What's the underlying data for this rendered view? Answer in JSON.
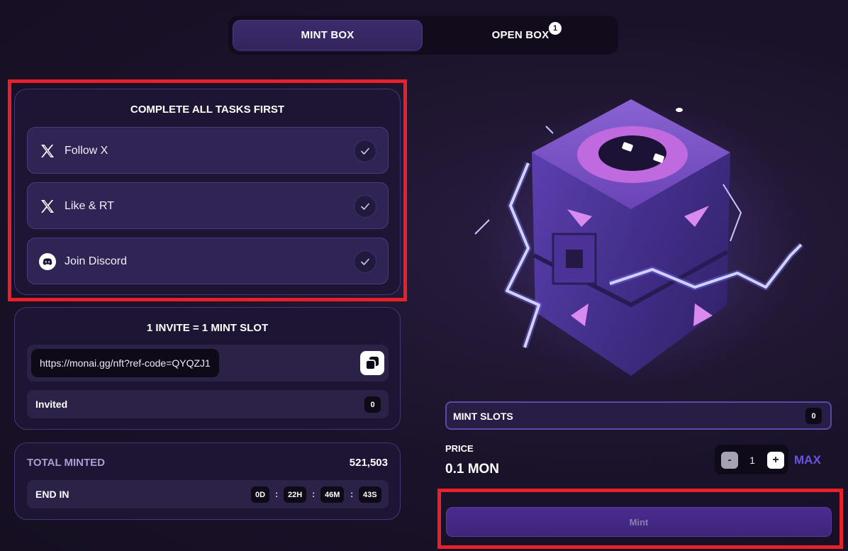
{
  "tabs": [
    {
      "label": "MINT BOX",
      "active": true
    },
    {
      "label": "OPEN BOX",
      "badge": "1"
    }
  ],
  "tasks": {
    "title": "COMPLETE ALL TASKS FIRST",
    "items": [
      {
        "label": "Follow X",
        "icon": "x-logo-icon",
        "done": true
      },
      {
        "label": "Like & RT",
        "icon": "x-logo-icon",
        "done": true
      },
      {
        "label": "Join Discord",
        "icon": "discord-icon",
        "done": true
      }
    ]
  },
  "invite": {
    "title": "1 INVITE = 1 MINT SLOT",
    "link": "https://monai.gg/nft?ref-code=QYQZJ1",
    "invited_label": "Invited",
    "invited_count": "0"
  },
  "stats": {
    "total_label": "TOTAL MINTED",
    "total_value": "521,503",
    "end_label": "END IN",
    "countdown": {
      "days": "0D",
      "hours": "22H",
      "minutes": "46M",
      "seconds": "43S"
    }
  },
  "mint": {
    "slots_label": "MINT SLOTS",
    "slots_count": "0",
    "price_label": "PRICE",
    "price_value": "0.1 MON",
    "quantity": "1",
    "minus": "-",
    "plus": "+",
    "max_label": "MAX",
    "button_label": "Mint"
  },
  "colors": {
    "background": "#1c142b",
    "panel": "#1e1534",
    "accent": "#6b52e6",
    "highlight": "#e8202a"
  }
}
